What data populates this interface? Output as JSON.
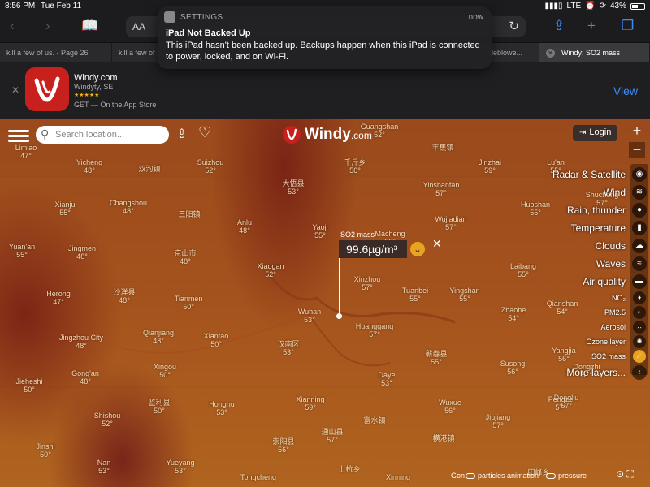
{
  "status_bar": {
    "time": "8:56 PM",
    "date": "Tue Feb 11",
    "carrier": "LTE",
    "battery": "43%",
    "battery_level": 0.43
  },
  "toolbar": {
    "text_size_label": "AA"
  },
  "tabs": [
    {
      "label": "kill a few of us. - Page 26"
    },
    {
      "label": "kill a few of"
    },
    {
      "label": "stleblowe..."
    },
    {
      "label": "Windy: SO2 mass"
    }
  ],
  "app_banner": {
    "name": "Windy.com",
    "publisher": "Windyty, SE",
    "stars": "★★★★★",
    "cta": "GET — On the App Store",
    "view_label": "View"
  },
  "notification": {
    "app": "SETTINGS",
    "time": "now",
    "title": "iPad Not Backed Up",
    "body": "This iPad hasn't been backed up. Backups happen when this iPad is connected to power, locked, and on Wi-Fi."
  },
  "map": {
    "search_placeholder": "Search location...",
    "logo_text": "Windy",
    "logo_suffix": ".com",
    "login_label": "Login",
    "zoom_in": "+",
    "zoom_out": "−",
    "popup": {
      "layer_name": "SO2 mass",
      "value": "99.6µg/m³"
    },
    "layers": [
      {
        "label": "Radar & Satellite",
        "icon": "satellite-icon",
        "size": "big"
      },
      {
        "label": "Wind",
        "icon": "wind-icon",
        "size": "big"
      },
      {
        "label": "Rain, thunder",
        "icon": "rain-icon",
        "size": "big"
      },
      {
        "label": "Temperature",
        "icon": "thermometer-icon",
        "size": "big"
      },
      {
        "label": "Clouds",
        "icon": "cloud-icon",
        "size": "big"
      },
      {
        "label": "Waves",
        "icon": "waves-icon",
        "size": "big"
      },
      {
        "label": "Air quality",
        "icon": "car-icon",
        "size": "big"
      },
      {
        "label": "NO₂",
        "icon": "no2-icon",
        "size": "small"
      },
      {
        "label": "PM2.5",
        "icon": "pm25-icon",
        "size": "small"
      },
      {
        "label": "Aerosol",
        "icon": "aerosol-icon",
        "size": "small"
      },
      {
        "label": "Ozone layer",
        "icon": "ozone-icon",
        "size": "small"
      },
      {
        "label": "SO2 mass",
        "icon": "so2-icon",
        "size": "small",
        "active": true
      },
      {
        "label": "More layers...",
        "icon": "chevron-left-icon",
        "size": "big"
      }
    ],
    "bottom": {
      "particles_label": "particles animation",
      "pressure_label": "pressure",
      "partial_label": "Gon"
    },
    "cities": [
      {
        "name": "Limiao",
        "value": "47°"
      },
      {
        "name": "Yicheng",
        "value": "48°"
      },
      {
        "name": "双沟镇",
        "value": ""
      },
      {
        "name": "Suizhou",
        "value": "52°"
      },
      {
        "name": "Xianju",
        "value": "55°"
      },
      {
        "name": "Changshou",
        "value": "48°"
      },
      {
        "name": "三阳镇",
        "value": ""
      },
      {
        "name": "大悟县",
        "value": "53°"
      },
      {
        "name": "Anlu",
        "value": "48°"
      },
      {
        "name": "Yaoji",
        "value": "55°"
      },
      {
        "name": "Guangshan",
        "value": "52°"
      },
      {
        "name": "丰集镇",
        "value": ""
      },
      {
        "name": "千斤乡",
        "value": "56°"
      },
      {
        "name": "Jinzhai",
        "value": "59°"
      },
      {
        "name": "Lu'an",
        "value": "55°"
      },
      {
        "name": "Yinshanfan",
        "value": "57°"
      },
      {
        "name": "Huoshan",
        "value": "55°"
      },
      {
        "name": "Shucheng",
        "value": "57°"
      },
      {
        "name": "Wujiadian",
        "value": "57°"
      },
      {
        "name": "Macheng",
        "value": "55°"
      },
      {
        "name": "Yuan'an",
        "value": "55°"
      },
      {
        "name": "Jingmen",
        "value": "48°"
      },
      {
        "name": "京山市",
        "value": "48°"
      },
      {
        "name": "Xiaogan",
        "value": "52°"
      },
      {
        "name": "Xinzhou",
        "value": "57°"
      },
      {
        "name": "Laibang",
        "value": "55°"
      },
      {
        "name": "Yingshan",
        "value": "55°"
      },
      {
        "name": "Herong",
        "value": "47°"
      },
      {
        "name": "沙洋县",
        "value": "48°"
      },
      {
        "name": "Tianmen",
        "value": "50°"
      },
      {
        "name": "Tuanbei",
        "value": "55°"
      },
      {
        "name": "Wuhan",
        "value": "53°"
      },
      {
        "name": "Qianshan",
        "value": "54°"
      },
      {
        "name": "Zhaohe",
        "value": "54°"
      },
      {
        "name": "Jingzhou City",
        "value": "48°"
      },
      {
        "name": "Qianjiang",
        "value": "48°"
      },
      {
        "name": "Xiantao",
        "value": "50°"
      },
      {
        "name": "汉南区",
        "value": "53°"
      },
      {
        "name": "Huanggang",
        "value": "57°"
      },
      {
        "name": "Yangjia",
        "value": "56°"
      },
      {
        "name": "蕲春县",
        "value": "55°"
      },
      {
        "name": "Susong",
        "value": "56°"
      },
      {
        "name": "Xingou",
        "value": "50°"
      },
      {
        "name": "Dongzhi",
        "value": "57°"
      },
      {
        "name": "Gong'an",
        "value": "48°"
      },
      {
        "name": "Jieheshi",
        "value": "50°"
      },
      {
        "name": "Daye",
        "value": "53°"
      },
      {
        "name": "Dongliu",
        "value": "57°"
      },
      {
        "name": "Shishou",
        "value": "52°"
      },
      {
        "name": "监利县",
        "value": "50°"
      },
      {
        "name": "Honghu",
        "value": "53°"
      },
      {
        "name": "Xianning",
        "value": "59°"
      },
      {
        "name": "Wuxue",
        "value": "56°"
      },
      {
        "name": "Pengze",
        "value": "57°"
      },
      {
        "name": "Jiujiang",
        "value": "57°"
      },
      {
        "name": "富水镇",
        "value": ""
      },
      {
        "name": "通山县",
        "value": "57°"
      },
      {
        "name": "Jinshi",
        "value": "50°"
      },
      {
        "name": "崇阳县",
        "value": "56°"
      },
      {
        "name": "横港镇",
        "value": ""
      },
      {
        "name": "Nan",
        "value": "53°"
      },
      {
        "name": "Yueyang",
        "value": "53°"
      },
      {
        "name": "Tongcheng",
        "value": ""
      },
      {
        "name": "Xinning",
        "value": ""
      },
      {
        "name": "上杭乡",
        "value": ""
      },
      {
        "name": "田峰乡",
        "value": ""
      }
    ]
  }
}
